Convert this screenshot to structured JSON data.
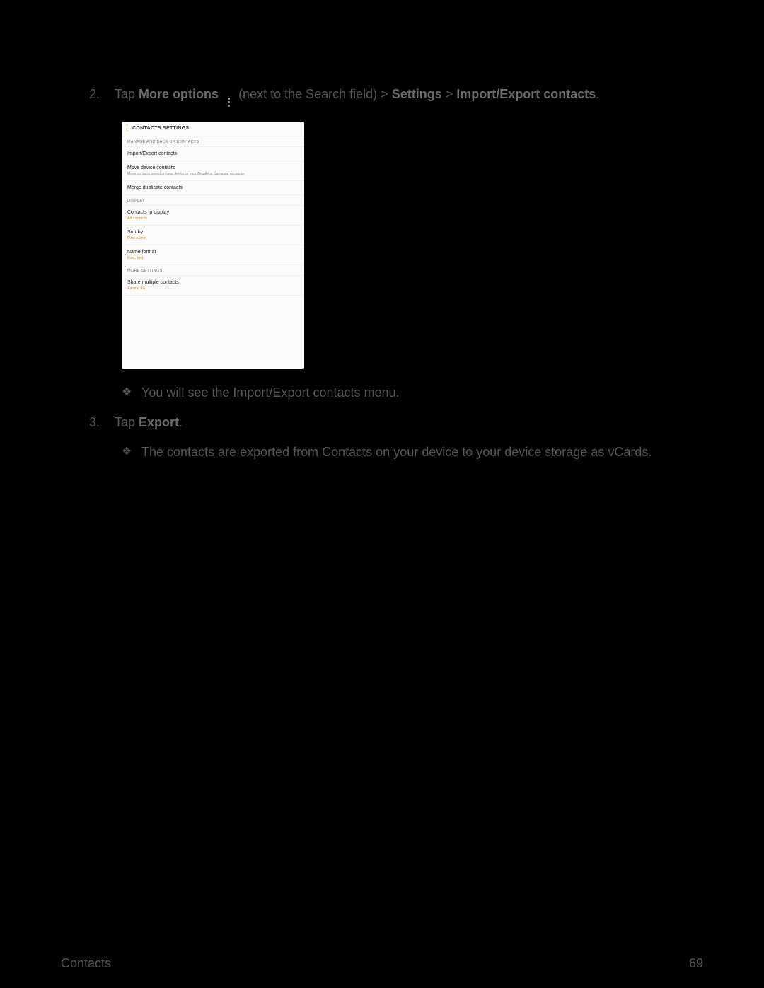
{
  "step2": {
    "number": "2.",
    "pre": "Tap ",
    "bold1": "More options",
    "mid": " (next to the Search field) > ",
    "bold2": "Settings",
    "sep": " > ",
    "bold3": "Import/Export contacts",
    "end": "."
  },
  "screenshot": {
    "title": "CONTACTS SETTINGS",
    "section1": "MANAGE AND BACK UP CONTACTS",
    "item1": "Import/Export contacts",
    "item2": "Move device contacts",
    "item2_sub": "Move contacts saved on your device to your Google or Samsung accounts.",
    "item3": "Merge duplicate contacts",
    "section2": "DISPLAY",
    "item4": "Contacts to display",
    "item4_val": "All contacts",
    "item5": "Sort by",
    "item5_val": "First name",
    "item6": "Name format",
    "item6_val": "First, last",
    "section3": "MORE SETTINGS",
    "item7": "Share multiple contacts",
    "item7_val": "As one file"
  },
  "note1": "You will see the Import/Export contacts menu.",
  "step3": {
    "number": "3.",
    "pre": "Tap ",
    "bold": "Export",
    "end": "."
  },
  "note2": "The contacts are exported from Contacts on your device to your device storage as vCards.",
  "footer_left": "Contacts",
  "footer_right": "69"
}
